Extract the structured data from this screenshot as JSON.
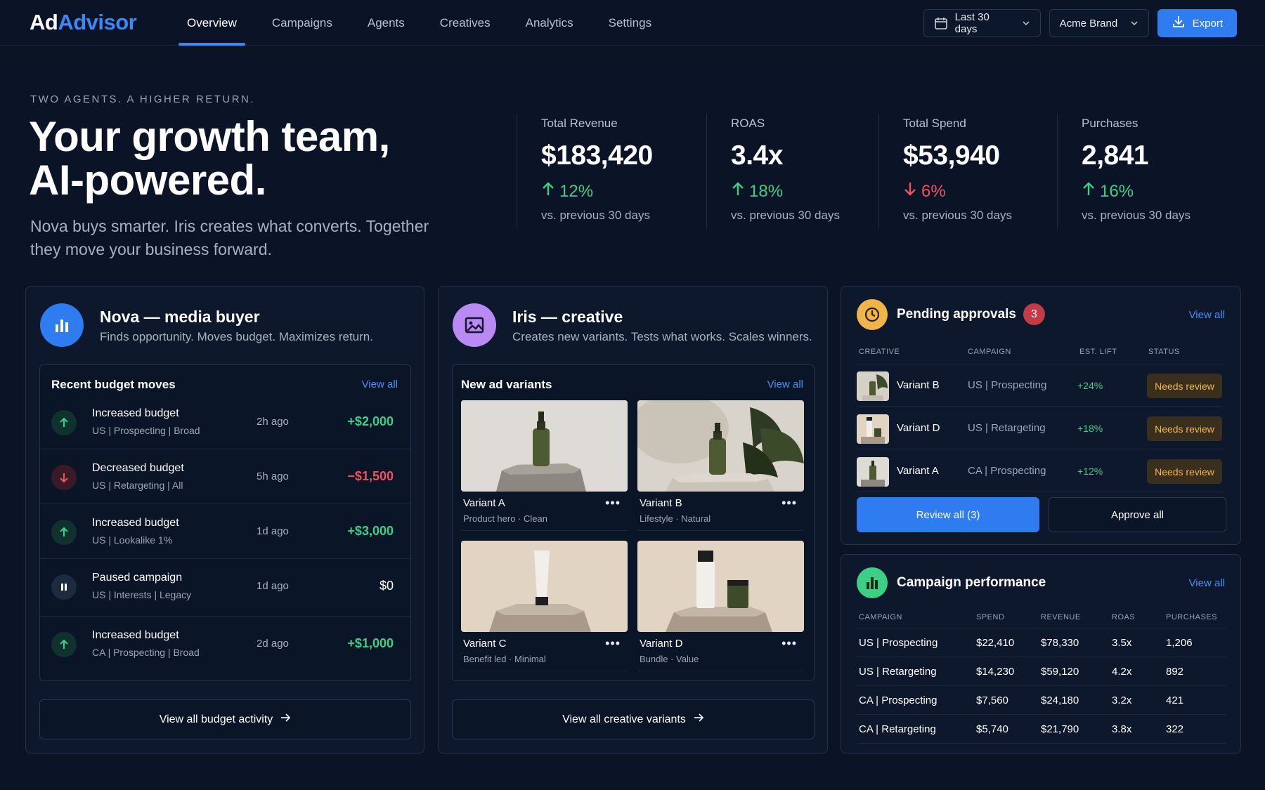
{
  "app": {
    "logo_primary": "Ad",
    "logo_accent": "Advisor",
    "accent_color": "#3f86f6"
  },
  "nav": {
    "tabs": [
      {
        "label": "Overview",
        "active": true
      },
      {
        "label": "Campaigns",
        "active": false
      },
      {
        "label": "Agents",
        "active": false
      },
      {
        "label": "Creatives",
        "active": false
      },
      {
        "label": "Analytics",
        "active": false
      },
      {
        "label": "Settings",
        "active": false
      }
    ],
    "date_range": "Last 30 days",
    "brand": "Acme Brand",
    "export_label": "Export"
  },
  "hero": {
    "eyebrow": "TWO AGENTS. A HIGHER RETURN.",
    "title_line1": "Your growth team,",
    "title_line2": "AI-powered.",
    "subtitle": "Nova buys smarter. Iris creates what converts. Together they move your business forward."
  },
  "kpis": [
    {
      "label": "Total Revenue",
      "value": "$183,420",
      "delta": "12%",
      "direction": "up",
      "compare": "vs. previous 30 days"
    },
    {
      "label": "ROAS",
      "value": "3.4x",
      "delta": "18%",
      "direction": "up",
      "compare": "vs. previous 30 days"
    },
    {
      "label": "Total Spend",
      "value": "$53,940",
      "delta": "6%",
      "direction": "down",
      "compare": "vs. previous 30 days"
    },
    {
      "label": "Purchases",
      "value": "2,841",
      "delta": "16%",
      "direction": "up",
      "compare": "vs. previous 30 days"
    }
  ],
  "nova": {
    "title": "Nova — media buyer",
    "desc": "Finds opportunity. Moves budget. Maximizes return.",
    "icon": "bar-chart-icon",
    "section_title": "Recent budget moves",
    "view_all": "View all",
    "moves": [
      {
        "action": "Increased budget",
        "target": "US | Prospecting | Broad",
        "time": "2h ago",
        "amount": "+$2,000",
        "kind": "up"
      },
      {
        "action": "Decreased budget",
        "target": "US | Retargeting | All",
        "time": "5h ago",
        "amount": "−$1,500",
        "kind": "down"
      },
      {
        "action": "Increased budget",
        "target": "US | Lookalike 1%",
        "time": "1d ago",
        "amount": "+$3,000",
        "kind": "up"
      },
      {
        "action": "Paused campaign",
        "target": "US | Interests | Legacy",
        "time": "1d ago",
        "amount": "$0",
        "kind": "pause"
      },
      {
        "action": "Increased budget",
        "target": "CA | Prospecting | Broad",
        "time": "2d ago",
        "amount": "+$1,000",
        "kind": "up"
      }
    ],
    "footer_button": "View all budget activity"
  },
  "iris": {
    "title": "Iris — creative",
    "desc": "Creates new variants. Tests what works. Scales winners.",
    "icon": "image-icon",
    "section_title": "New ad variants",
    "view_all": "View all",
    "variants": [
      {
        "name": "Variant A",
        "tags": "Product hero · Clean"
      },
      {
        "name": "Variant B",
        "tags": "Lifestyle · Natural"
      },
      {
        "name": "Variant C",
        "tags": "Benefit led · Minimal"
      },
      {
        "name": "Variant D",
        "tags": "Bundle · Value"
      }
    ],
    "more_glyph": "•••",
    "footer_button": "View all creative variants"
  },
  "approvals": {
    "title": "Pending approvals",
    "count": "3",
    "view_all": "View all",
    "icon": "clock-icon",
    "headers": [
      "CREATIVE",
      "CAMPAIGN",
      "EST. LIFT",
      "STATUS"
    ],
    "rows": [
      {
        "creative": "Variant B",
        "campaign": "US | Prospecting",
        "lift": "+24%",
        "status": "Needs review"
      },
      {
        "creative": "Variant D",
        "campaign": "US | Retargeting",
        "lift": "+18%",
        "status": "Needs review"
      },
      {
        "creative": "Variant A",
        "campaign": "CA | Prospecting",
        "lift": "+12%",
        "status": "Needs review"
      }
    ],
    "review_all": "Review all (3)",
    "approve_all": "Approve all"
  },
  "performance": {
    "title": "Campaign performance",
    "view_all": "View all",
    "icon": "bar-chart-icon",
    "headers": [
      "CAMPAIGN",
      "SPEND",
      "REVENUE",
      "ROAS",
      "PURCHASES"
    ],
    "rows": [
      {
        "campaign": "US | Prospecting",
        "spend": "$22,410",
        "revenue": "$78,330",
        "roas": "3.5x",
        "purchases": "1,206"
      },
      {
        "campaign": "US | Retargeting",
        "spend": "$14,230",
        "revenue": "$59,120",
        "roas": "4.2x",
        "purchases": "892"
      },
      {
        "campaign": "CA | Prospecting",
        "spend": "$7,560",
        "revenue": "$24,180",
        "roas": "3.2x",
        "purchases": "421"
      },
      {
        "campaign": "CA | Retargeting",
        "spend": "$5,740",
        "revenue": "$21,790",
        "roas": "3.8x",
        "purchases": "322"
      }
    ]
  }
}
